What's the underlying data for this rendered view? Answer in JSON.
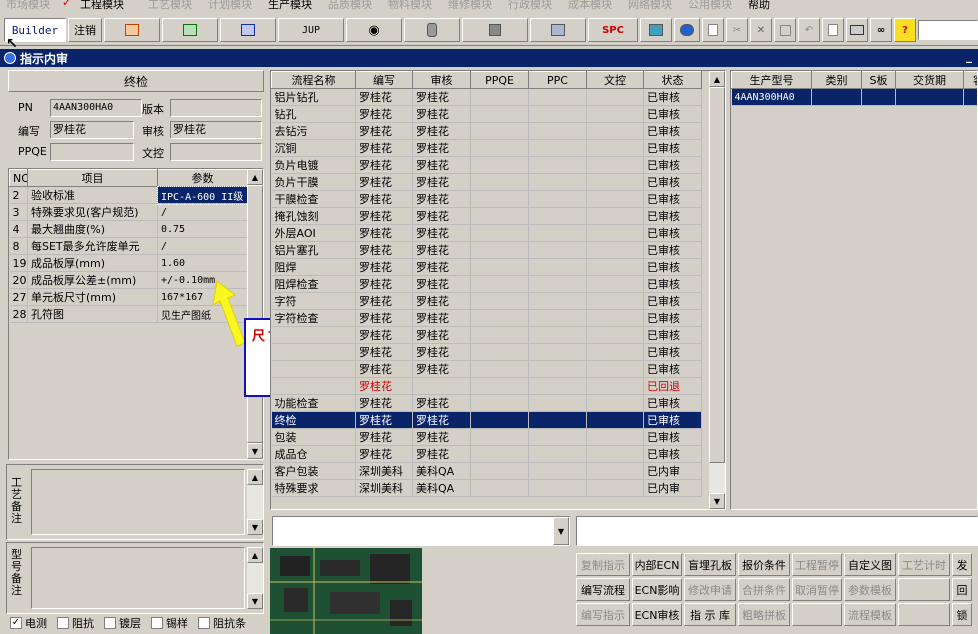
{
  "menubar": {
    "items": [
      "市场模块",
      "工程模块",
      "工艺模块",
      "计划模块",
      "生产模块",
      "品质模块",
      "物料模块",
      "维修模块",
      "行政模块",
      "成本模块",
      "网络模块",
      "公用模块",
      "帮助"
    ]
  },
  "toolbar": {
    "builder": "Builder",
    "logout": "注销",
    "jup": "JUP",
    "spc": "SPC"
  },
  "window": {
    "title": "指示内审"
  },
  "left": {
    "section_title": "终检",
    "pn_label": "PN",
    "pn_value": "4AAN300HA0",
    "version_label": "版本",
    "version_value": "",
    "editor_label": "编写",
    "editor_value": "罗桂花",
    "reviewer_label": "审核",
    "reviewer_value": "罗桂花",
    "ppqe_label": "PPQE",
    "ppqe_value": "",
    "doc_label": "文控",
    "doc_value": "",
    "params_headers": [
      "NO",
      "项目",
      "参数"
    ],
    "params": [
      {
        "no": "2",
        "item": "验收标准",
        "value": "IPC-A-600 II级"
      },
      {
        "no": "3",
        "item": "特殊要求见(客户规范)",
        "value": "/"
      },
      {
        "no": "4",
        "item": "最大翘曲度(%)",
        "value": "0.75"
      },
      {
        "no": "8",
        "item": "每SET最多允许废单元",
        "value": "/"
      },
      {
        "no": "19",
        "item": "成品板厚(mm)",
        "value": "1.60"
      },
      {
        "no": "20",
        "item": "成品板厚公差±(mm)",
        "value": "+/-0.10mm"
      },
      {
        "no": "27",
        "item": "单元板尺寸(mm)",
        "value": "167*167"
      },
      {
        "no": "28",
        "item": "孔符图",
        "value": "见生产图纸"
      }
    ],
    "note_process": "工艺备注",
    "note_model": "型号备注",
    "checkboxes": [
      {
        "label": "电测",
        "checked": true
      },
      {
        "label": "阻抗",
        "checked": false
      },
      {
        "label": "镀层",
        "checked": false
      },
      {
        "label": "锡样",
        "checked": false
      },
      {
        "label": "阻抗条",
        "checked": false
      }
    ]
  },
  "annotation": {
    "text": "尺寸不对"
  },
  "flow": {
    "headers": [
      "流程名称",
      "编写",
      "审核",
      "PPQE",
      "PPC",
      "文控",
      "状态"
    ],
    "rows": [
      {
        "name": "铝片钻孔",
        "editor": "罗桂花",
        "reviewer": "罗桂花",
        "status": "已审核"
      },
      {
        "name": "钻孔",
        "editor": "罗桂花",
        "reviewer": "罗桂花",
        "status": "已审核"
      },
      {
        "name": "去钻污",
        "editor": "罗桂花",
        "reviewer": "罗桂花",
        "status": "已审核"
      },
      {
        "name": "沉铜",
        "editor": "罗桂花",
        "reviewer": "罗桂花",
        "status": "已审核"
      },
      {
        "name": "负片电镀",
        "editor": "罗桂花",
        "reviewer": "罗桂花",
        "status": "已审核"
      },
      {
        "name": "负片干膜",
        "editor": "罗桂花",
        "reviewer": "罗桂花",
        "status": "已审核"
      },
      {
        "name": "干膜检查",
        "editor": "罗桂花",
        "reviewer": "罗桂花",
        "status": "已审核"
      },
      {
        "name": "掩孔蚀刻",
        "editor": "罗桂花",
        "reviewer": "罗桂花",
        "status": "已审核"
      },
      {
        "name": "外层AOI",
        "editor": "罗桂花",
        "reviewer": "罗桂花",
        "status": "已审核"
      },
      {
        "name": "铝片塞孔",
        "editor": "罗桂花",
        "reviewer": "罗桂花",
        "status": "已审核"
      },
      {
        "name": "阻焊",
        "editor": "罗桂花",
        "reviewer": "罗桂花",
        "status": "已审核"
      },
      {
        "name": "阻焊检查",
        "editor": "罗桂花",
        "reviewer": "罗桂花",
        "status": "已审核"
      },
      {
        "name": "字符",
        "editor": "罗桂花",
        "reviewer": "罗桂花",
        "status": "已审核"
      },
      {
        "name": "字符检查",
        "editor": "罗桂花",
        "reviewer": "罗桂花",
        "status": "已审核"
      },
      {
        "name": "",
        "editor": "罗桂花",
        "reviewer": "罗桂花",
        "status": "已审核"
      },
      {
        "name": "",
        "editor": "罗桂花",
        "reviewer": "罗桂花",
        "status": "已审核"
      },
      {
        "name": "",
        "editor": "罗桂花",
        "reviewer": "罗桂花",
        "status": "已审核"
      },
      {
        "name": "",
        "editor": "罗桂花",
        "reviewer": "",
        "status": "已回退",
        "returned": true
      },
      {
        "name": "功能检查",
        "editor": "罗桂花",
        "reviewer": "罗桂花",
        "status": "已审核"
      },
      {
        "name": "终检",
        "editor": "罗桂花",
        "reviewer": "罗桂花",
        "status": "已审核",
        "selected": true
      },
      {
        "name": "包装",
        "editor": "罗桂花",
        "reviewer": "罗桂花",
        "status": "已审核"
      },
      {
        "name": "成品仓",
        "editor": "罗桂花",
        "reviewer": "罗桂花",
        "status": "已审核"
      },
      {
        "name": "客户包装",
        "editor": "深圳美科",
        "reviewer": "美科QA",
        "status": "已内审"
      },
      {
        "name": "特殊要求",
        "editor": "深圳美科",
        "reviewer": "美科QA",
        "status": "已内审"
      }
    ]
  },
  "models": {
    "headers": [
      "生产型号",
      "类别",
      "S板",
      "交货期",
      "客"
    ],
    "rows": [
      {
        "model": "4AAN300HA0"
      }
    ]
  },
  "buttons": [
    [
      {
        "label": "复制指示",
        "enabled": false
      },
      {
        "label": "内部ECN",
        "enabled": true
      },
      {
        "label": "盲埋孔板",
        "enabled": true
      },
      {
        "label": "报价条件",
        "enabled": true
      },
      {
        "label": "工程暂停",
        "enabled": false
      },
      {
        "label": "自定义图",
        "enabled": true
      },
      {
        "label": "工艺计时",
        "enabled": false
      },
      {
        "label": "发",
        "enabled": true
      }
    ],
    [
      {
        "label": "编写流程",
        "enabled": true
      },
      {
        "label": "ECN影响",
        "enabled": true
      },
      {
        "label": "修改申请",
        "enabled": false
      },
      {
        "label": "合拼条件",
        "enabled": false
      },
      {
        "label": "取消暂停",
        "enabled": false
      },
      {
        "label": "参数模板",
        "enabled": false
      },
      {
        "label": "",
        "enabled": false
      },
      {
        "label": "回",
        "enabled": true
      }
    ],
    [
      {
        "label": "编写指示",
        "enabled": false
      },
      {
        "label": "ECN审核",
        "enabled": true
      },
      {
        "label": "指 示 库",
        "enabled": true
      },
      {
        "label": "粗略拼板",
        "enabled": false
      },
      {
        "label": "",
        "enabled": false
      },
      {
        "label": "流程模板",
        "enabled": false
      },
      {
        "label": "",
        "enabled": false
      },
      {
        "label": "锁",
        "enabled": true
      }
    ]
  ]
}
